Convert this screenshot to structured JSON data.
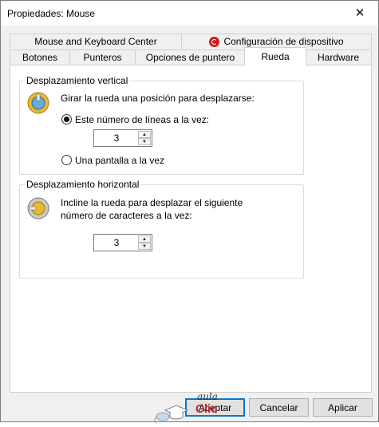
{
  "window": {
    "title": "Propiedades: Mouse",
    "close_glyph": "✕"
  },
  "tabs_top": [
    {
      "label": "Mouse and Keyboard Center"
    },
    {
      "label": "Configuración de dispositivo",
      "icon": "red-circle-icon"
    }
  ],
  "tabs_bottom": [
    {
      "label": "Botones"
    },
    {
      "label": "Punteros"
    },
    {
      "label": "Opciones de puntero"
    },
    {
      "label": "Rueda",
      "active": true
    },
    {
      "label": "Hardware"
    }
  ],
  "vertical": {
    "legend": "Desplazamiento vertical",
    "instruction": "Girar la rueda una posición para desplazarse:",
    "option_lines": "Este número de líneas a la vez:",
    "option_lines_checked": true,
    "lines_value": "3",
    "option_screen": "Una pantalla a la vez",
    "option_screen_checked": false
  },
  "horizontal": {
    "legend": "Desplazamiento horizontal",
    "instruction_line1": "Incline la rueda para desplazar el siguiente",
    "instruction_line2": "número de caracteres a la vez:",
    "chars_value": "3"
  },
  "logo": {
    "top": "aula",
    "bottom": "Clic"
  },
  "buttons": {
    "ok": "Aceptar",
    "cancel": "Cancelar",
    "apply": "Aplicar"
  },
  "colors": {
    "accent": "#0078d7",
    "logo_red": "#c0282d"
  }
}
